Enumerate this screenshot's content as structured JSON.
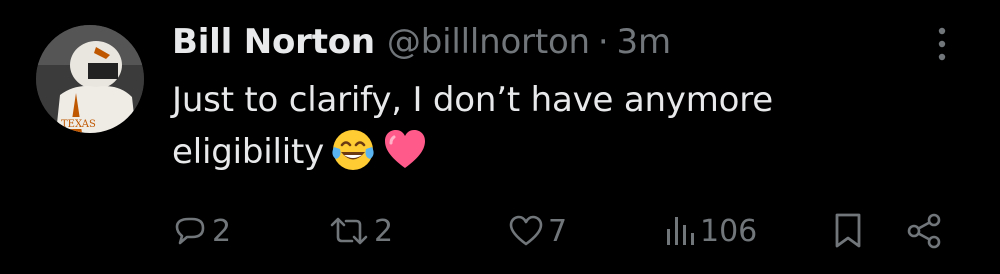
{
  "tweet": {
    "display_name": "Bill Norton",
    "handle": "@billlnorton",
    "separator": "·",
    "timestamp": "3m",
    "text_line1": "Just to clarify, I don’t have anymore",
    "text_line2": "eligibility",
    "emojis": [
      "face-with-tears-of-joy",
      "pink-heart"
    ]
  },
  "avatar": {
    "jersey_text": "TEXAS"
  },
  "actions": {
    "reply_count": "2",
    "retweet_count": "2",
    "like_count": "7",
    "views_count": "106"
  },
  "colors": {
    "background": "#000000",
    "primary_text": "#e7e9ea",
    "secondary_text": "#71767b",
    "heart": "#ff5a8a",
    "emoji_yellow": "#ffcc33"
  },
  "icons": [
    "more-icon",
    "reply-icon",
    "retweet-icon",
    "like-icon",
    "views-icon",
    "bookmark-icon",
    "share-icon"
  ]
}
